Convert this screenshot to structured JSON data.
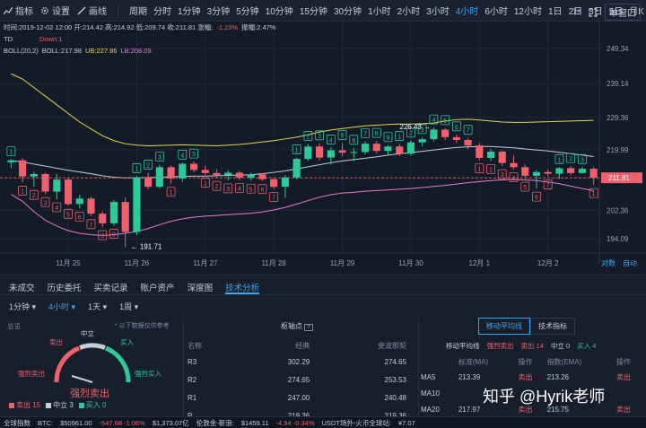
{
  "toolbar": {
    "indicators_label": "指标",
    "settings_label": "设置",
    "draw_label": "画线",
    "period_label": "周期",
    "periods": [
      "分时",
      "1分钟",
      "3分钟",
      "5分钟",
      "10分钟",
      "15分钟",
      "30分钟",
      "1小时",
      "2小时",
      "3小时",
      "4小时",
      "6小时",
      "12小时",
      "1日",
      "2日",
      "3日",
      "5日",
      "月K"
    ],
    "active_period": "4小时",
    "interval_1s": "1s",
    "window_label": "单窗口"
  },
  "legend": {
    "ohlc": "时间:2019-12-02 12:00  开:214.42  高:214.92  低:209.74  收:211.81  涨幅:",
    "change": "-1.23%",
    "amp": "振幅:2.47%",
    "td_label": "TD",
    "td_value": "Down:1",
    "boll_label": "BOLL(20,2)",
    "boll_mid": "BOLL:217.98",
    "boll_ub": "UB:227.86",
    "boll_lb": "LB:208.09"
  },
  "chart_data": {
    "type": "candlestick",
    "y_range": [
      190.5,
      253
    ],
    "y_ticks": [
      "249.34",
      "239.14",
      "229.36",
      "219.99",
      "211.81",
      "202.36",
      "194.09"
    ],
    "y_tick_values": [
      249.34,
      239.14,
      229.36,
      219.99,
      211.81,
      202.36,
      194.09
    ],
    "current_price": "211.81",
    "x_labels": [
      "11月 25",
      "11月 26",
      "11月 27",
      "11月 28",
      "11月 29",
      "11月 30",
      "12月 1",
      "12月 2"
    ],
    "x_label_index": [
      5,
      11,
      17,
      23,
      29,
      35,
      41,
      47
    ],
    "low_marker": "191.71",
    "high_marker": "226.43",
    "candles": [
      [
        216.3,
        217.2,
        214.6,
        216.9
      ],
      [
        216.9,
        217.5,
        210.4,
        212.2
      ],
      [
        212.2,
        213.6,
        209.2,
        212.9
      ],
      [
        212.9,
        213.3,
        207.1,
        207.8
      ],
      [
        207.8,
        212.9,
        205.6,
        211.3
      ],
      [
        211.3,
        211.9,
        203.7,
        204.2
      ],
      [
        204.2,
        206.9,
        202.9,
        205.8
      ],
      [
        205.8,
        206.3,
        200.7,
        201.4
      ],
      [
        201.4,
        202.1,
        197.5,
        198.6
      ],
      [
        198.6,
        205.4,
        197.9,
        204.8
      ],
      [
        204.8,
        206.1,
        191.7,
        196.1
      ],
      [
        196.1,
        212.3,
        195.2,
        211.9
      ],
      [
        211.9,
        213.3,
        208.4,
        209.2
      ],
      [
        209.2,
        215.6,
        208.7,
        214.9
      ],
      [
        214.9,
        215.4,
        210.1,
        211.6
      ],
      [
        211.6,
        216.2,
        210.6,
        215.9
      ],
      [
        215.9,
        216.5,
        213.4,
        214.1
      ],
      [
        214.1,
        215.3,
        212.7,
        213.2
      ],
      [
        213.2,
        214.3,
        211.8,
        212.6
      ],
      [
        212.6,
        214.0,
        211.1,
        213.3
      ],
      [
        213.3,
        213.8,
        211.2,
        211.9
      ],
      [
        211.9,
        213.4,
        211.0,
        212.8
      ],
      [
        212.8,
        213.1,
        210.9,
        211.4
      ],
      [
        211.4,
        211.9,
        208.6,
        209.2
      ],
      [
        209.2,
        212.6,
        206.0,
        211.9
      ],
      [
        211.9,
        217.7,
        211.4,
        217.3
      ],
      [
        217.3,
        221.6,
        216.8,
        220.9
      ],
      [
        220.9,
        221.8,
        216.9,
        217.7
      ],
      [
        217.7,
        220.6,
        215.7,
        219.8
      ],
      [
        219.8,
        221.9,
        218.1,
        219.1
      ],
      [
        219.1,
        220.5,
        216.7,
        219.3
      ],
      [
        219.3,
        222.4,
        218.7,
        221.7
      ],
      [
        221.7,
        222.5,
        218.8,
        219.6
      ],
      [
        219.6,
        221.3,
        218.4,
        220.9
      ],
      [
        220.9,
        221.6,
        218.1,
        218.8
      ],
      [
        218.8,
        222.6,
        218.3,
        222.1
      ],
      [
        222.1,
        223.6,
        220.9,
        223.0
      ],
      [
        223.0,
        226.4,
        222.4,
        225.8
      ],
      [
        225.8,
        226.2,
        222.8,
        223.6
      ],
      [
        223.6,
        224.4,
        221.9,
        222.8
      ],
      [
        222.8,
        223.4,
        220.1,
        221.2
      ],
      [
        221.2,
        221.9,
        216.9,
        217.6
      ],
      [
        217.6,
        220.2,
        216.7,
        219.4
      ],
      [
        219.4,
        219.8,
        215.2,
        216.1
      ],
      [
        216.1,
        218.3,
        214.3,
        214.9
      ],
      [
        214.9,
        215.7,
        211.6,
        212.4
      ],
      [
        212.4,
        214.1,
        208.7,
        213.5
      ],
      [
        213.5,
        214.3,
        212.2,
        213.0
      ],
      [
        213.0,
        214.9,
        211.5,
        214.6
      ],
      [
        214.6,
        215.2,
        212.6,
        213.2
      ],
      [
        213.2,
        214.9,
        212.9,
        214.42
      ],
      [
        214.42,
        214.92,
        209.74,
        211.81
      ]
    ],
    "boll_upper": [
      242,
      240.5,
      238,
      235.5,
      233,
      230.5,
      228,
      226,
      224,
      222.6,
      221.7,
      221.3,
      221.1,
      221.2,
      221.3,
      221.4,
      221.3,
      221.2,
      221.1,
      221.3,
      221.5,
      221.8,
      222.2,
      222.6,
      223.1,
      223.6,
      224.3,
      225.1,
      225.7,
      226.1,
      226.5,
      226.9,
      227.1,
      227.3,
      227.4,
      227.4,
      227.5,
      227.7,
      228.3,
      228.7,
      228.8,
      228.6,
      228.3,
      228.0,
      227.9,
      227.9,
      228.0,
      228.1,
      228.2,
      228.3,
      228.4,
      228.5
    ],
    "boll_mid": [
      216.8,
      216.4,
      215.8,
      215.2,
      214.6,
      214.0,
      213.5,
      213.0,
      212.4,
      212.0,
      211.8,
      211.8,
      211.9,
      212.0,
      212.1,
      212.2,
      212.3,
      212.3,
      212.4,
      212.5,
      212.6,
      212.7,
      213.0,
      213.4,
      213.8,
      214.4,
      215.0,
      215.6,
      216.2,
      216.7,
      217.1,
      217.5,
      217.9,
      218.4,
      218.8,
      219.1,
      219.5,
      219.9,
      220.3,
      220.6,
      220.8,
      220.9,
      220.9,
      220.7,
      220.5,
      220.2,
      219.9,
      219.6,
      219.2,
      218.8,
      218.4,
      217.98
    ],
    "boll_lower": [
      207,
      205,
      202,
      199.5,
      197.8,
      196.5,
      195.7,
      195.3,
      195.1,
      195.3,
      195.7,
      196.2,
      197.1,
      198.2,
      199.2,
      199.9,
      200.4,
      200.7,
      200.9,
      201.1,
      201.3,
      201.5,
      201.9,
      202.5,
      203.2,
      204.2,
      205.2,
      206.2,
      206.9,
      207.4,
      207.6,
      207.9,
      208.1,
      208.3,
      208.5,
      208.7,
      209.0,
      209.3,
      209.6,
      210.0,
      210.4,
      210.7,
      211.0,
      211.2,
      211.3,
      211.2,
      211.0,
      210.6,
      210.1,
      209.4,
      208.7,
      208.09
    ],
    "td_marks": [
      {
        "i": 0,
        "n": "1",
        "type": "buy"
      },
      {
        "i": 1,
        "n": "1",
        "type": "sell"
      },
      {
        "i": 2,
        "n": "2",
        "type": "sell"
      },
      {
        "i": 3,
        "n": "3",
        "type": "sell"
      },
      {
        "i": 4,
        "n": "4",
        "type": "sell"
      },
      {
        "i": 5,
        "n": "5",
        "type": "sell"
      },
      {
        "i": 6,
        "n": "6",
        "type": "sell"
      },
      {
        "i": 7,
        "n": "7",
        "type": "sell"
      },
      {
        "i": 8,
        "n": "8",
        "type": "sell"
      },
      {
        "i": 9,
        "n": "9",
        "type": "sell"
      },
      {
        "i": 11,
        "n": "1",
        "type": "buy"
      },
      {
        "i": 12,
        "n": "2",
        "type": "buy"
      },
      {
        "i": 13,
        "n": "3",
        "type": "buy"
      },
      {
        "i": 14,
        "n": "1",
        "type": "sell"
      },
      {
        "i": 15,
        "n": "4",
        "type": "buy"
      },
      {
        "i": 16,
        "n": "5",
        "type": "buy"
      },
      {
        "i": 17,
        "n": "1",
        "type": "sell"
      },
      {
        "i": 18,
        "n": "2",
        "type": "sell"
      },
      {
        "i": 19,
        "n": "3",
        "type": "sell"
      },
      {
        "i": 20,
        "n": "4",
        "type": "sell"
      },
      {
        "i": 21,
        "n": "5",
        "type": "sell"
      },
      {
        "i": 22,
        "n": "6",
        "type": "sell"
      },
      {
        "i": 23,
        "n": "7",
        "type": "sell"
      },
      {
        "i": 25,
        "n": "1",
        "type": "buy"
      },
      {
        "i": 26,
        "n": "2",
        "type": "buy"
      },
      {
        "i": 27,
        "n": "3",
        "type": "buy"
      },
      {
        "i": 28,
        "n": "4",
        "type": "buy"
      },
      {
        "i": 29,
        "n": "5",
        "type": "buy"
      },
      {
        "i": 30,
        "n": "6",
        "type": "buy"
      },
      {
        "i": 31,
        "n": "7",
        "type": "buy"
      },
      {
        "i": 32,
        "n": "8",
        "type": "buy"
      },
      {
        "i": 33,
        "n": "9",
        "type": "buy"
      },
      {
        "i": 34,
        "n": "1",
        "type": "buy"
      },
      {
        "i": 35,
        "n": "2",
        "type": "buy"
      },
      {
        "i": 36,
        "n": "3",
        "type": "buy"
      },
      {
        "i": 37,
        "n": "4",
        "type": "buy"
      },
      {
        "i": 38,
        "n": "5",
        "type": "buy"
      },
      {
        "i": 39,
        "n": "6",
        "type": "buy"
      },
      {
        "i": 40,
        "n": "7",
        "type": "buy"
      },
      {
        "i": 41,
        "n": "1",
        "type": "sell"
      },
      {
        "i": 42,
        "n": "2",
        "type": "sell"
      },
      {
        "i": 43,
        "n": "3",
        "type": "sell"
      },
      {
        "i": 44,
        "n": "4",
        "type": "sell"
      },
      {
        "i": 45,
        "n": "5",
        "type": "sell"
      },
      {
        "i": 46,
        "n": "6",
        "type": "sell"
      },
      {
        "i": 47,
        "n": "7",
        "type": "sell"
      },
      {
        "i": 48,
        "n": "1",
        "type": "buy"
      },
      {
        "i": 49,
        "n": "2",
        "type": "buy"
      },
      {
        "i": 50,
        "n": "3",
        "type": "buy"
      },
      {
        "i": 51,
        "n": "1",
        "type": "sell"
      }
    ],
    "corner_labels": [
      "对数",
      "自动"
    ]
  },
  "tabs": [
    "未成交",
    "历史委托",
    "买卖记录",
    "账户资产",
    "深度图",
    "技术分析"
  ],
  "active_tab": "技术分析",
  "subtabs": [
    "1分钟",
    "4小时",
    "1天",
    "1周"
  ],
  "active_subtab": "4小时",
  "summary": {
    "title": "总览",
    "neutral": "中立",
    "note": "* 以下数据仅供参考",
    "sell": "卖出",
    "buy": "买入",
    "strong_sell": "强烈卖出",
    "strong_buy": "强烈买入",
    "result": "强烈卖出",
    "count_sell": "卖出 15",
    "count_neutral": "中立 3",
    "count_buy": "买入 0"
  },
  "pivot": {
    "title": "枢轴点",
    "headers": [
      "名称",
      "经典",
      "斐波那契"
    ],
    "rows": [
      [
        "R3",
        "302.29",
        "274.65"
      ],
      [
        "R2",
        "274.65",
        "253.53"
      ],
      [
        "R1",
        "247.00",
        "240.48"
      ],
      [
        "P",
        "219.36",
        "219.36"
      ]
    ]
  },
  "ma": {
    "tabs": [
      "移动平均线",
      "技术指标"
    ],
    "summary_label": "移动平均线",
    "summary_value": "强烈卖出",
    "sell": "卖出 14",
    "neutral": "中立 0",
    "buy": "买入 4",
    "headers": [
      "",
      "标准(MA)",
      "操作",
      "指数(EMA)",
      "操作"
    ],
    "rows": [
      [
        "MA5",
        "213.39",
        "卖出",
        "213.26",
        "卖出"
      ],
      [
        "MA10",
        "",
        "",
        "",
        ""
      ],
      [
        "MA20",
        "217.97",
        "卖出",
        "215.75",
        "卖出"
      ]
    ]
  },
  "watermark": "知乎 @Hyrik老师",
  "status": {
    "label": "全球指数",
    "btc": "BTC:",
    "btc_price": "$50961.00",
    "btc_chg": "-547.68 -1.06%",
    "btc_val": "$1,373.07亿",
    "lun": "伦敦金-新浪:",
    "lun_price": "$1459.11",
    "lun_chg": "-4.94 -0.34%",
    "usdt": "USDT场外-火币全球站:",
    "usdt_price": "¥7.07"
  },
  "colors": {
    "up": "#2ec99b",
    "down": "#f0616d",
    "upper": "#e6d84f",
    "mid": "#c7cedb",
    "lower": "#e57ec9"
  }
}
